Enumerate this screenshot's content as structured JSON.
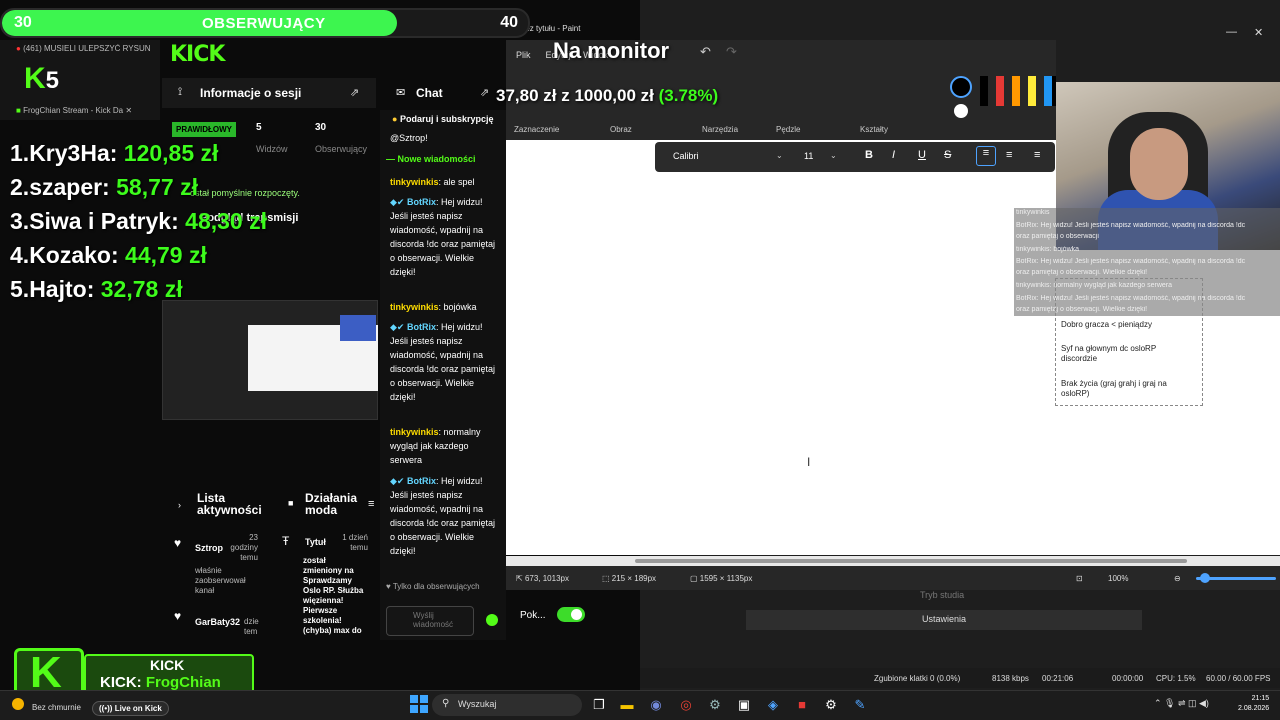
{
  "follower_goal": {
    "current": "30",
    "title": "OBSERWUJĄCY",
    "target": "40",
    "progress": 0.75
  },
  "browser": {
    "tab1": "(461) MUSIELI ULEPSZYĆ RYSUN",
    "tab2": "FrogChian Stream - Kick Da",
    "tab_close": "✕",
    "logo": "KICK",
    "small_logo_num": "5"
  },
  "leaderboard": [
    {
      "rank": "1.",
      "name": "Kry3Ha:",
      "amount": "120,85 zł"
    },
    {
      "rank": "2.",
      "name": "szaper:",
      "amount": "58,77 zł"
    },
    {
      "rank": "3.",
      "name": "Siwa i Patryk:",
      "amount": "48,30 zł"
    },
    {
      "rank": "4.",
      "name": "Kozako:",
      "amount": "44,79 zł"
    },
    {
      "rank": "5.",
      "name": "Hajto:",
      "amount": "32,78 zł"
    }
  ],
  "session": {
    "title": "Informacje o sesji",
    "badge": "PRAWIDŁOWY",
    "viewers_value": "5",
    "viewers_label": "Widzów",
    "followers_value": "30",
    "followers_label": "Obserwujący",
    "success_note": "ostał pomyślnie rozpoczęty.",
    "preview_title": "Podgląd transmisji"
  },
  "activity": {
    "title": "Lista aktywności",
    "items": [
      {
        "name": "Sztrop",
        "time": "23 godziny temu",
        "text": "właśnie zaobserwował kanał"
      },
      {
        "name": "GarBaty32",
        "time": "dzie tem",
        "text": ""
      }
    ]
  },
  "mod": {
    "title": "Działania moda",
    "item_label": "Tytuł",
    "item_time": "1 dzień temu",
    "item_text": "został zmieniony na Sprawdzamy Oslo RP. Służba więzienna! Pierwsze szkolenia! (chyba) max do"
  },
  "chat": {
    "header": "Chat",
    "sub_banner": "Podaruj i subskrypcję",
    "mention": "@Sztrop!",
    "new_messages": "Nowe wiadomości",
    "messages": [
      {
        "user": "tinkywinkis",
        "text": "ale spel",
        "type": "tink"
      },
      {
        "user": "BotRix",
        "text": "Hej widzu! Jeśli jesteś napisz wiadomość, wpadnij na discorda !dc oraz pamiętaj o obserwacji. Wielkie dzięki!",
        "type": "bot"
      },
      {
        "user": "tinkywinkis",
        "text": "bojówka",
        "type": "tink"
      },
      {
        "user": "BotRix",
        "text": "Hej widzu! Jeśli jesteś napisz wiadomość, wpadnij na discorda !dc oraz pamiętaj o obserwacji. Wielkie dzięki!",
        "type": "bot"
      },
      {
        "user": "tinkywinkis",
        "text": "normalny wygląd jak kazdego serwera",
        "type": "tink"
      },
      {
        "user": "BotRix",
        "text": "Hej widzu! Jeśli jesteś napisz wiadomość, wpadnij na discorda !dc oraz pamiętaj o obserwacji. Wielkie dzięki!",
        "type": "bot"
      }
    ],
    "followers_only": "Tylko dla obserwujących",
    "input_placeholder": "Wyślij wiadomość",
    "toggle_label": "Pok..."
  },
  "paint": {
    "window_title": "Bez tytułu - Paint",
    "overlay_title": "Na monitor",
    "menu_file": "Plik",
    "menu_edit": "Edytuj",
    "menu_view": "Widok",
    "donation_current": "37,80 zł",
    "donation_sep": "z",
    "donation_target": "1000,00 zł",
    "donation_pct": "(3.78%)",
    "ribbon_labels": [
      "Zaznaczenie",
      "Obraz",
      "Narzędzia",
      "Pędzle",
      "Kształty"
    ],
    "font_name": "Calibri",
    "font_size": "11",
    "textbox_lines": [
      "Dobro gracza < pieniądzy",
      "Syf na głownym dc osloRP discordzie",
      "Brak życia (graj grahj i graj na osloRP)"
    ],
    "status": {
      "cursor": "673, 1013px",
      "selection": "215 × 189px",
      "canvas": "1595 × 1135px",
      "zoom": "100%"
    }
  },
  "chat_overlay_lines": [
    "tinkywinkis",
    "BotRix: Hej widzu! Jeśli jesteś napisz wiadomość, wpadnij na discorda !dc",
    "oraz pamiętaj o obserwacji",
    "tinkywinkis: bojówka",
    "BotRix: Hej widzu! Jeśli jesteś napisz wiadomość, wpadnij na discorda !dc",
    "oraz pamiętaj o obserwacji. Wielkie dzięki!",
    "tinkywinkis: normalny wygląd jak kazdego serwera",
    "BotRix: Hej widzu! Jeśli jesteś napisz wiadomość, wpadnij na discorda !dc",
    "oraz pamiętaj o obserwacji. Wielkie dzięki!"
  ],
  "obs": {
    "studio_mode": "Tryb studia",
    "settings": "Ustawienia",
    "dropped": "Zgubione klatki 0 (0.0%)",
    "bitrate": "8138 kbps",
    "live_time": "00:21:06",
    "rec_time": "00:00:00",
    "cpu": "CPU: 1.5%",
    "fps": "60.00 / 60.00 FPS"
  },
  "kick_overlay": {
    "line1": "KICK",
    "line2_prefix": "KICK:",
    "line2_name": "FrogChian",
    "live": "Live on Kick"
  },
  "taskbar": {
    "search": "Wyszukaj",
    "weather": "Bez chmurnie",
    "time": "21:15",
    "date": "2.08.2026"
  },
  "colors": {
    "kick_green": "#53fc18",
    "goal_green": "#3df54f",
    "amount_green": "#3dfc1c"
  }
}
